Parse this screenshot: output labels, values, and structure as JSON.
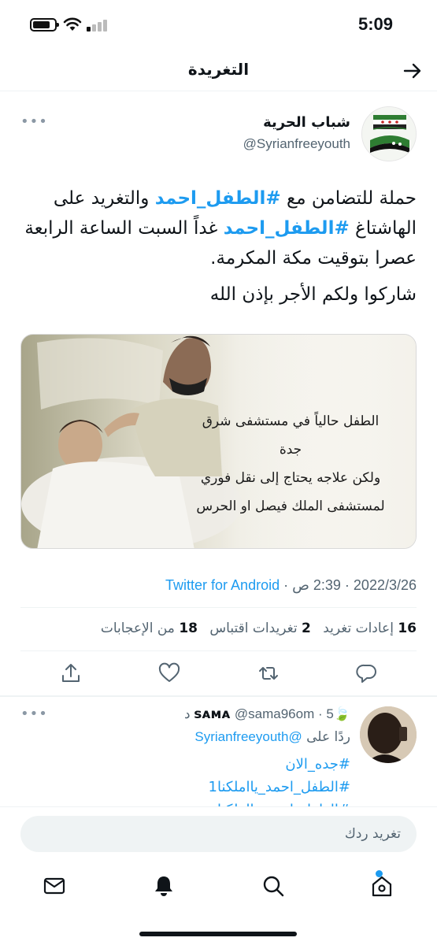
{
  "status_bar": {
    "time": "5:09"
  },
  "header": {
    "title": "التغريدة"
  },
  "tweet": {
    "author_name": "شباب الحرية",
    "author_handle": "@Syrianfreeyouth",
    "text_part1": "حملة للتضامن مع ",
    "hashtag1": "#الطفل_احمد",
    "text_part2": " والتغريد على الهاشتاغ ",
    "hashtag2": "#الطفل_احمد",
    "text_part3": " غداً السبت الساعة الرابعة عصرا بتوقيت مكة المكرمة.",
    "text_line2": "شاركوا ولكم الأجر بإذن الله",
    "media_text": {
      "line1": "الطفل حالياً في مستشفى شرق جدة",
      "line2": "ولكن علاجه يحتاج إلى نقل فوري",
      "line3": "لمستشفى الملك فيصل او الحرس"
    },
    "date": "2022/3/26",
    "time": "2:39 ص",
    "separator": " · ",
    "source": "Twitter for Android",
    "stats": {
      "retweets_count": "16",
      "retweets_label": "إعادات تغريد",
      "quotes_count": "2",
      "quotes_label": "تغريدات اقتباس",
      "likes_count": "18",
      "likes_label": "من الإعجابات"
    }
  },
  "reply": {
    "author_name": "sᴀмᴀ",
    "author_emoji": "🍃",
    "handle": "@sama96om",
    "age": "5 د",
    "replying_label": "ردًا على",
    "replying_to": "@Syrianfreeyouth",
    "lines": [
      "#جده_الان",
      "#الطفل_احمد_يااملكنا1",
      "#الطفل_احمد_يااملكنا"
    ]
  },
  "composer": {
    "placeholder": "تغريد ردك"
  },
  "colors": {
    "accent": "#1d9bf0",
    "text": "#0f1419",
    "muted": "#536471"
  }
}
